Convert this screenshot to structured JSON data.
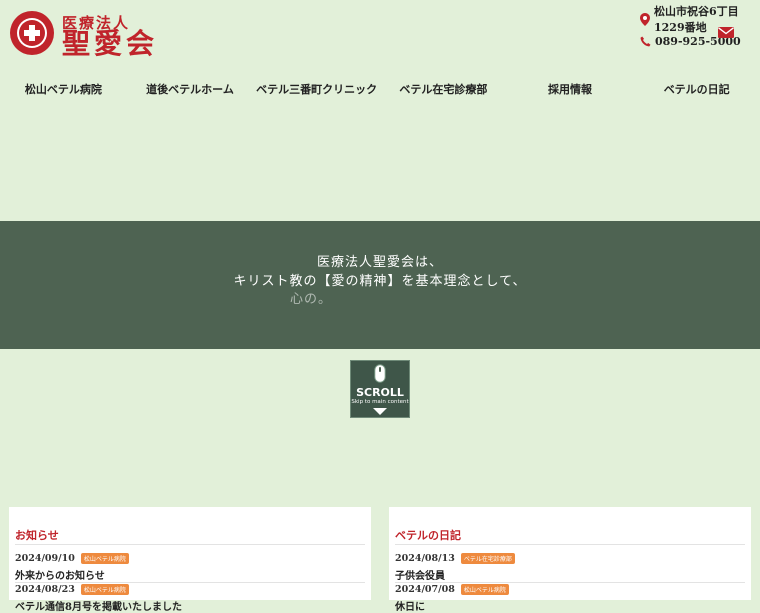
{
  "brand": {
    "sub": "医療法人",
    "main": "聖愛会",
    "logo_ring_text": "MEDICAL CORPORATION BETHEL"
  },
  "contact": {
    "address": "松山市祝谷6丁目1229番地",
    "phone": "089-925-5000",
    "icons": [
      "location-pin-icon",
      "phone-icon",
      "mail-icon"
    ]
  },
  "nav": {
    "items": [
      {
        "label": "松山ベテル病院"
      },
      {
        "label": "道後ベテルホーム"
      },
      {
        "label": "ベテル三番町クリニック"
      },
      {
        "label": "ベテル在宅診療部"
      },
      {
        "label": "採用情報"
      },
      {
        "label": "ベテルの日記"
      }
    ]
  },
  "hero": {
    "line1": "医療法人聖愛会は、",
    "line2": "キリスト教の【愛の精神】を基本理念として、",
    "line3": "心の。"
  },
  "scroll": {
    "label": "SCROLL",
    "sub": "Skip to main content"
  },
  "news": {
    "title": "お知らせ",
    "entries": [
      {
        "date": "2024/09/10",
        "badge": "松山ベテル病院",
        "title": "外来からのお知らせ"
      },
      {
        "date": "2024/08/23",
        "badge": "松山ベテル病院",
        "title": "ベテル通信8月号を掲載いたしました"
      }
    ]
  },
  "diary": {
    "title": "ベテルの日記",
    "entries": [
      {
        "date": "2024/08/13",
        "badge": "ベテル在宅診療部",
        "title": "子供会役員"
      },
      {
        "date": "2024/07/08",
        "badge": "松山ベテル病院",
        "title": "休日に"
      }
    ]
  },
  "colors": {
    "background": "#e2f0d9",
    "brand_red": "#c0242b",
    "hero_bg": "#4e6352",
    "badge": "#ee8a3e"
  }
}
